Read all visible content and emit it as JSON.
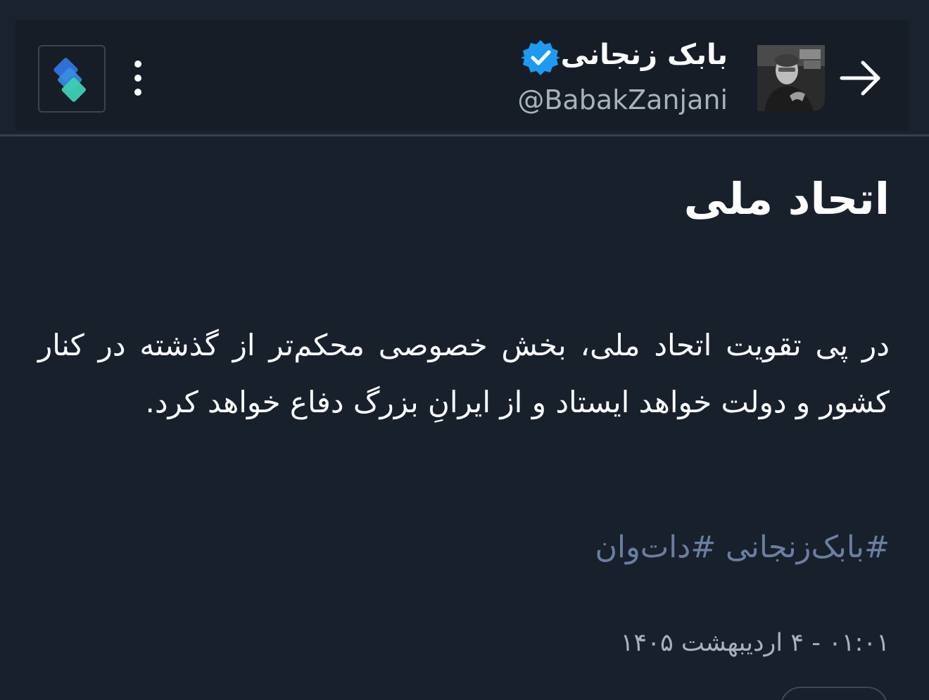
{
  "header": {
    "display_name": "بابک زنجانی",
    "handle": "@BabakZanjani",
    "back_icon": "arrow-right-icon",
    "verified_icon": "verified-badge-icon",
    "more_icon": "vertical-dots-icon",
    "app_logo_icon": "app-logo-icon"
  },
  "tweet": {
    "title": "اتحاد ملی",
    "body": "در پی تقویت اتحاد ملی، بخش خصوصی محکم‌تر از گذشته در کنار کشور و دولت خواهد ایستاد و از ایرانِ بزرگ دفاع خواهد کرد.",
    "hashtags": [
      "#بابک‌زنجانی",
      "#دات‌وان"
    ],
    "timestamp": "۰۱:۰۱ - ۴ اردیبهشت ۱۴۰۵"
  },
  "colors": {
    "background": "#18202c",
    "hashtag": "#6b7fa0",
    "verified": "#1d9bf0",
    "secondary_text": "#a8b2bd"
  }
}
